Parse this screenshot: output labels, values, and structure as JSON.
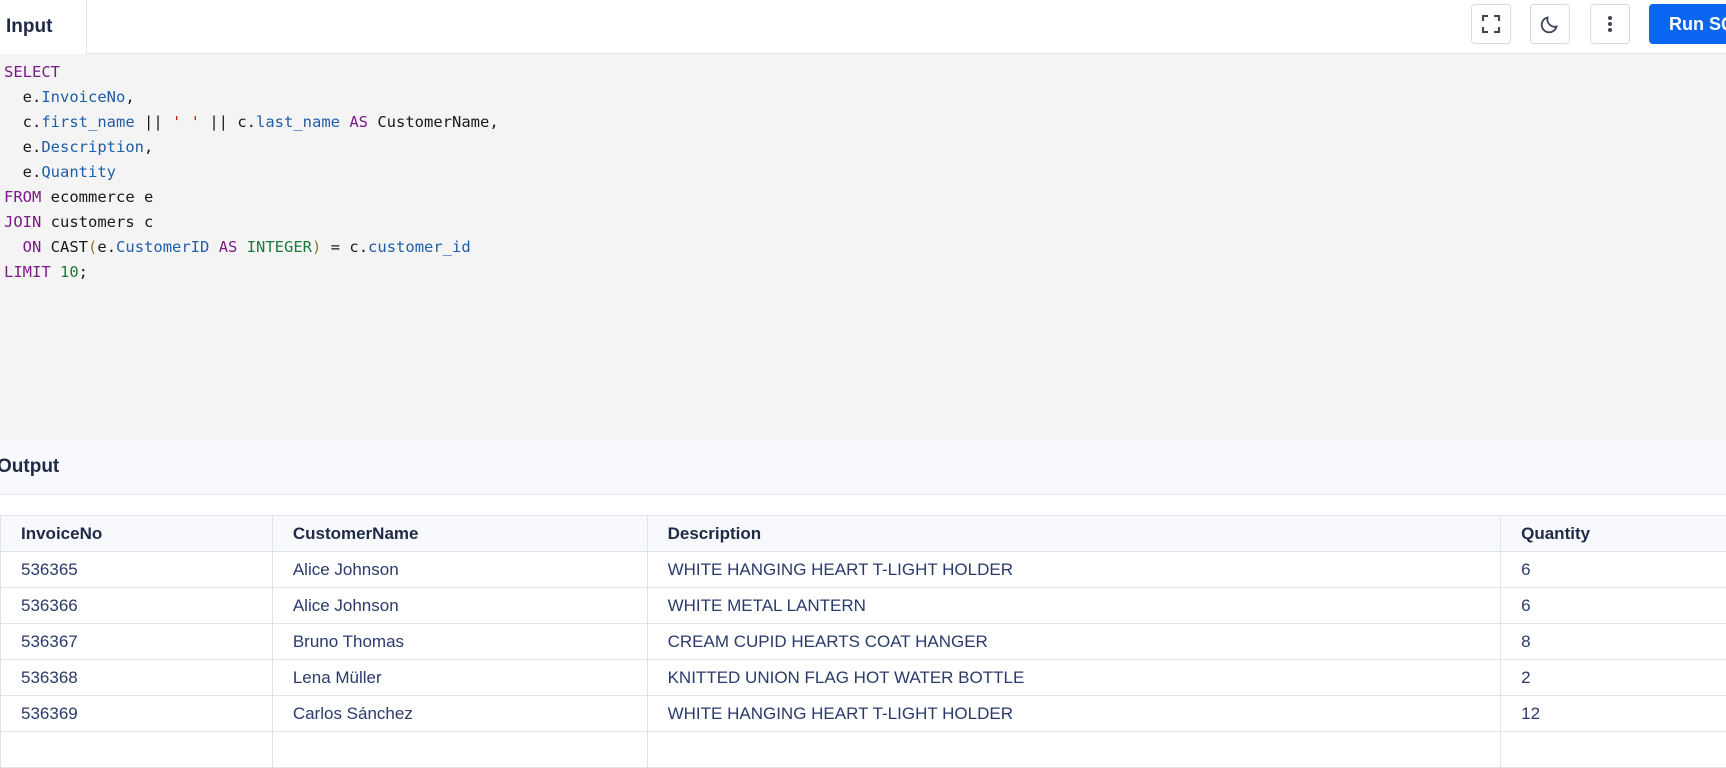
{
  "tabs": {
    "input_label": "Input"
  },
  "toolbar": {
    "fullscreen_icon": "fullscreen-icon",
    "theme_icon": "moon-icon",
    "more_icon": "more-vertical-icon",
    "run_label": "Run SQL"
  },
  "editor": {
    "line1": {
      "kw": "SELECT"
    },
    "line2": {
      "alias": "e.",
      "field": "InvoiceNo",
      "tail": ","
    },
    "line3": {
      "alias": "c.",
      "field": "first_name",
      "op1": " || ",
      "str": "' '",
      "op2": " || ",
      "alias2": "c.",
      "field2": "last_name",
      "kw": " AS ",
      "name": "CustomerName",
      "tail": ","
    },
    "line4": {
      "alias": "e.",
      "field": "Description",
      "tail": ","
    },
    "line5": {
      "alias": "e.",
      "field": "Quantity"
    },
    "line6": {
      "kw": "FROM",
      "rest": " ecommerce e"
    },
    "line7": {
      "kw": "JOIN",
      "rest": " customers c"
    },
    "line8": {
      "kw": "ON",
      "fn": " CAST",
      "open": "(",
      "alias": "e.",
      "field": "CustomerID",
      "kw2": " AS ",
      "type": "INTEGER",
      "close": ")",
      "op": " = ",
      "alias2": "c.",
      "field2": "customer_id"
    },
    "line9": {
      "kw": "LIMIT",
      "num": " 10",
      "tail": ";"
    }
  },
  "output": {
    "title": "Output",
    "columns": [
      "InvoiceNo",
      "CustomerName",
      "Description",
      "Quantity"
    ],
    "rows": [
      [
        "536365",
        "Alice Johnson",
        "WHITE HANGING HEART T-LIGHT HOLDER",
        "6"
      ],
      [
        "536366",
        "Alice Johnson",
        "WHITE METAL LANTERN",
        "6"
      ],
      [
        "536367",
        "Bruno Thomas",
        "CREAM CUPID HEARTS COAT HANGER",
        "8"
      ],
      [
        "536368",
        "Lena Müller",
        "KNITTED UNION FLAG HOT WATER BOTTLE",
        "2"
      ],
      [
        "536369",
        "Carlos Sánchez",
        "WHITE HANGING HEART T-LIGHT HOLDER",
        "12"
      ],
      [
        "",
        "",
        "",
        ""
      ]
    ]
  },
  "colors": {
    "accent": "#0a65f0",
    "editor_bg": "#f4f4f5",
    "keyword": "#7a1a86",
    "identifier": "#1f5ea8",
    "string": "#c41a16",
    "number": "#1d7a3a"
  }
}
